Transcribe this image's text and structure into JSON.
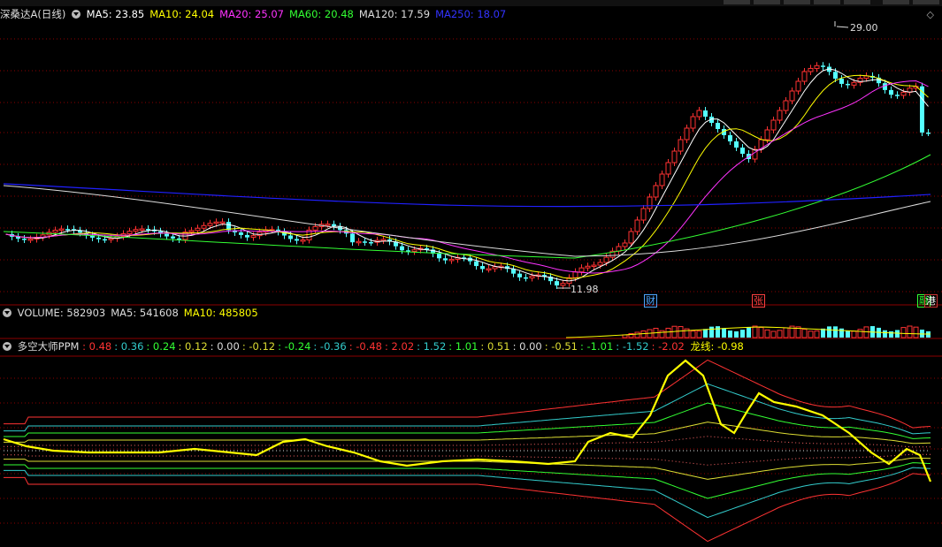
{
  "main_legend": {
    "name": "深桑达A",
    "period": "(日线)",
    "ma": [
      {
        "label": "MA5: 23.85",
        "color": "#ffffff"
      },
      {
        "label": "MA10: 24.04",
        "color": "#ffff00"
      },
      {
        "label": "MA20: 25.07",
        "color": "#ff33ff"
      },
      {
        "label": "MA60: 20.48",
        "color": "#33ff33"
      },
      {
        "label": "MA120: 17.59",
        "color": "#dddddd"
      },
      {
        "label": "MA250: 18.07",
        "color": "#3333ff"
      }
    ]
  },
  "price_marks": {
    "high": "29.00",
    "low": "11.98"
  },
  "event_tags": [
    {
      "text": "财",
      "color": "#4da6ff",
      "border": "#4da6ff"
    },
    {
      "text": "张",
      "color": "#ff4040",
      "border": "#ff4040"
    },
    {
      "text": "融",
      "color": "#33ff33",
      "border": "#33ff33"
    },
    {
      "text": "港",
      "color": "#ffffff",
      "border": "#cc3333"
    }
  ],
  "volume_legend": {
    "items": [
      {
        "label": "VOLUME: 582903",
        "color": "#dddddd"
      },
      {
        "label": "MA5: 541608",
        "color": "#dddddd"
      },
      {
        "label": "MA10: 485805",
        "color": "#ffff00"
      }
    ]
  },
  "ppm_legend": {
    "name": "多空大师PPM",
    "values": [
      {
        "label": ": 0.48",
        "color": "#ff3333"
      },
      {
        "label": ": 0.36",
        "color": "#33cccc"
      },
      {
        "label": ": 0.24",
        "color": "#33ff33"
      },
      {
        "label": ": 0.12",
        "color": "#dddd33"
      },
      {
        "label": ": 0.00",
        "color": "#dddddd"
      },
      {
        "label": ": -0.12",
        "color": "#dddd33"
      },
      {
        "label": ": -0.24",
        "color": "#33ff33"
      },
      {
        "label": ": -0.36",
        "color": "#33cccc"
      },
      {
        "label": ": -0.48",
        "color": "#ff3333"
      },
      {
        "label": ": 2.02",
        "color": "#ff3333"
      },
      {
        "label": ": 1.52",
        "color": "#33cccc"
      },
      {
        "label": ": 1.01",
        "color": "#33ff33"
      },
      {
        "label": ": 0.51",
        "color": "#dddd33"
      },
      {
        "label": ": 0.00",
        "color": "#dddddd"
      },
      {
        "label": ": -0.51",
        "color": "#dddd33"
      },
      {
        "label": ": -1.01",
        "color": "#33ff33"
      },
      {
        "label": ": -1.52",
        "color": "#33cccc"
      },
      {
        "label": ": -2.02",
        "color": "#ff3333"
      }
    ],
    "dragon_label": "龙线: -0.98",
    "dragon_color": "#ffff00"
  },
  "colors": {
    "up": "#ff3232",
    "down": "#54ffff",
    "grid": "#8b0000",
    "ma250": "#2020ff"
  }
}
